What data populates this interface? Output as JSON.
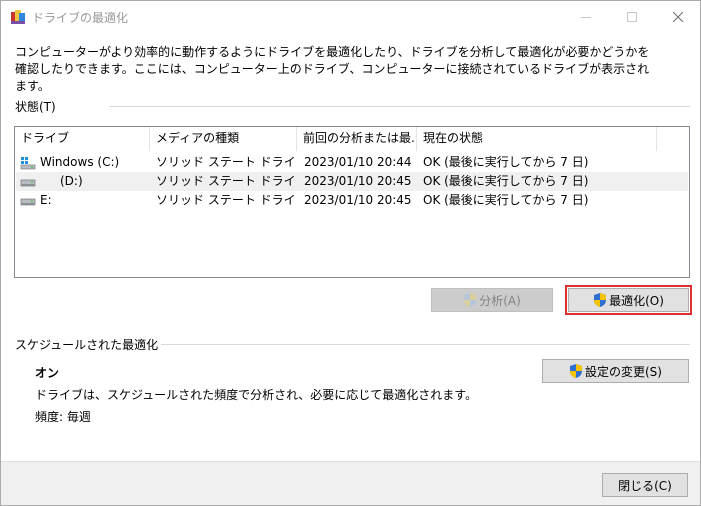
{
  "window": {
    "title": "ドライブの最適化",
    "icons": {
      "app": "defrag-app-icon",
      "minimize": "minimize-icon",
      "maximize": "maximize-icon",
      "close": "close-icon"
    }
  },
  "description": "コンピューターがより効率的に動作するようにドライブを最適化したり、ドライブを分析して最適化が必要かどうかを確認したりできます。ここには、コンピューター上のドライブ、コンピューターに接続されているドライブが表示されます。",
  "status_section": {
    "label": "状態(T)",
    "columns": [
      "ドライブ",
      "メディアの種類",
      "前回の分析または最...",
      "現在の状態"
    ],
    "drives": [
      {
        "name": "Windows (C:)",
        "media_type": "ソリッド ステート ドライブ",
        "last_analyzed": "2023/01/10 20:44",
        "status": "OK (最後に実行してから 7 日)",
        "icon": "windows-drive-icon",
        "selected": false
      },
      {
        "name": "(D:)",
        "media_type": "ソリッド ステート ドライブ",
        "last_analyzed": "2023/01/10 20:45",
        "status": "OK (最後に実行してから 7 日)",
        "icon": "drive-icon",
        "selected": true
      },
      {
        "name": "E:",
        "media_type": "ソリッド ステート ドライブ",
        "last_analyzed": "2023/01/10 20:45",
        "status": "OK (最後に実行してから 7 日)",
        "icon": "drive-icon",
        "selected": false
      }
    ]
  },
  "buttons": {
    "analyze": {
      "label": "分析(A)",
      "enabled": false,
      "icon": "uac-shield-icon"
    },
    "optimize": {
      "label": "最適化(O)",
      "enabled": true,
      "icon": "uac-shield-icon",
      "highlighted": true
    },
    "change_settings": {
      "label": "設定の変更(S)",
      "icon": "uac-shield-icon"
    },
    "close": {
      "label": "閉じる(C)"
    }
  },
  "schedule_section": {
    "label": "スケジュールされた最適化",
    "state": "オン",
    "description": "ドライブは、スケジュールされた頻度で分析され、必要に応じて最適化されます。",
    "frequency": "頻度: 毎週"
  },
  "colors": {
    "highlight_border": "#e03131",
    "selected_row": "#f0f0f0",
    "shield_blue": "#2f6fd1",
    "shield_yellow": "#f5c400"
  }
}
